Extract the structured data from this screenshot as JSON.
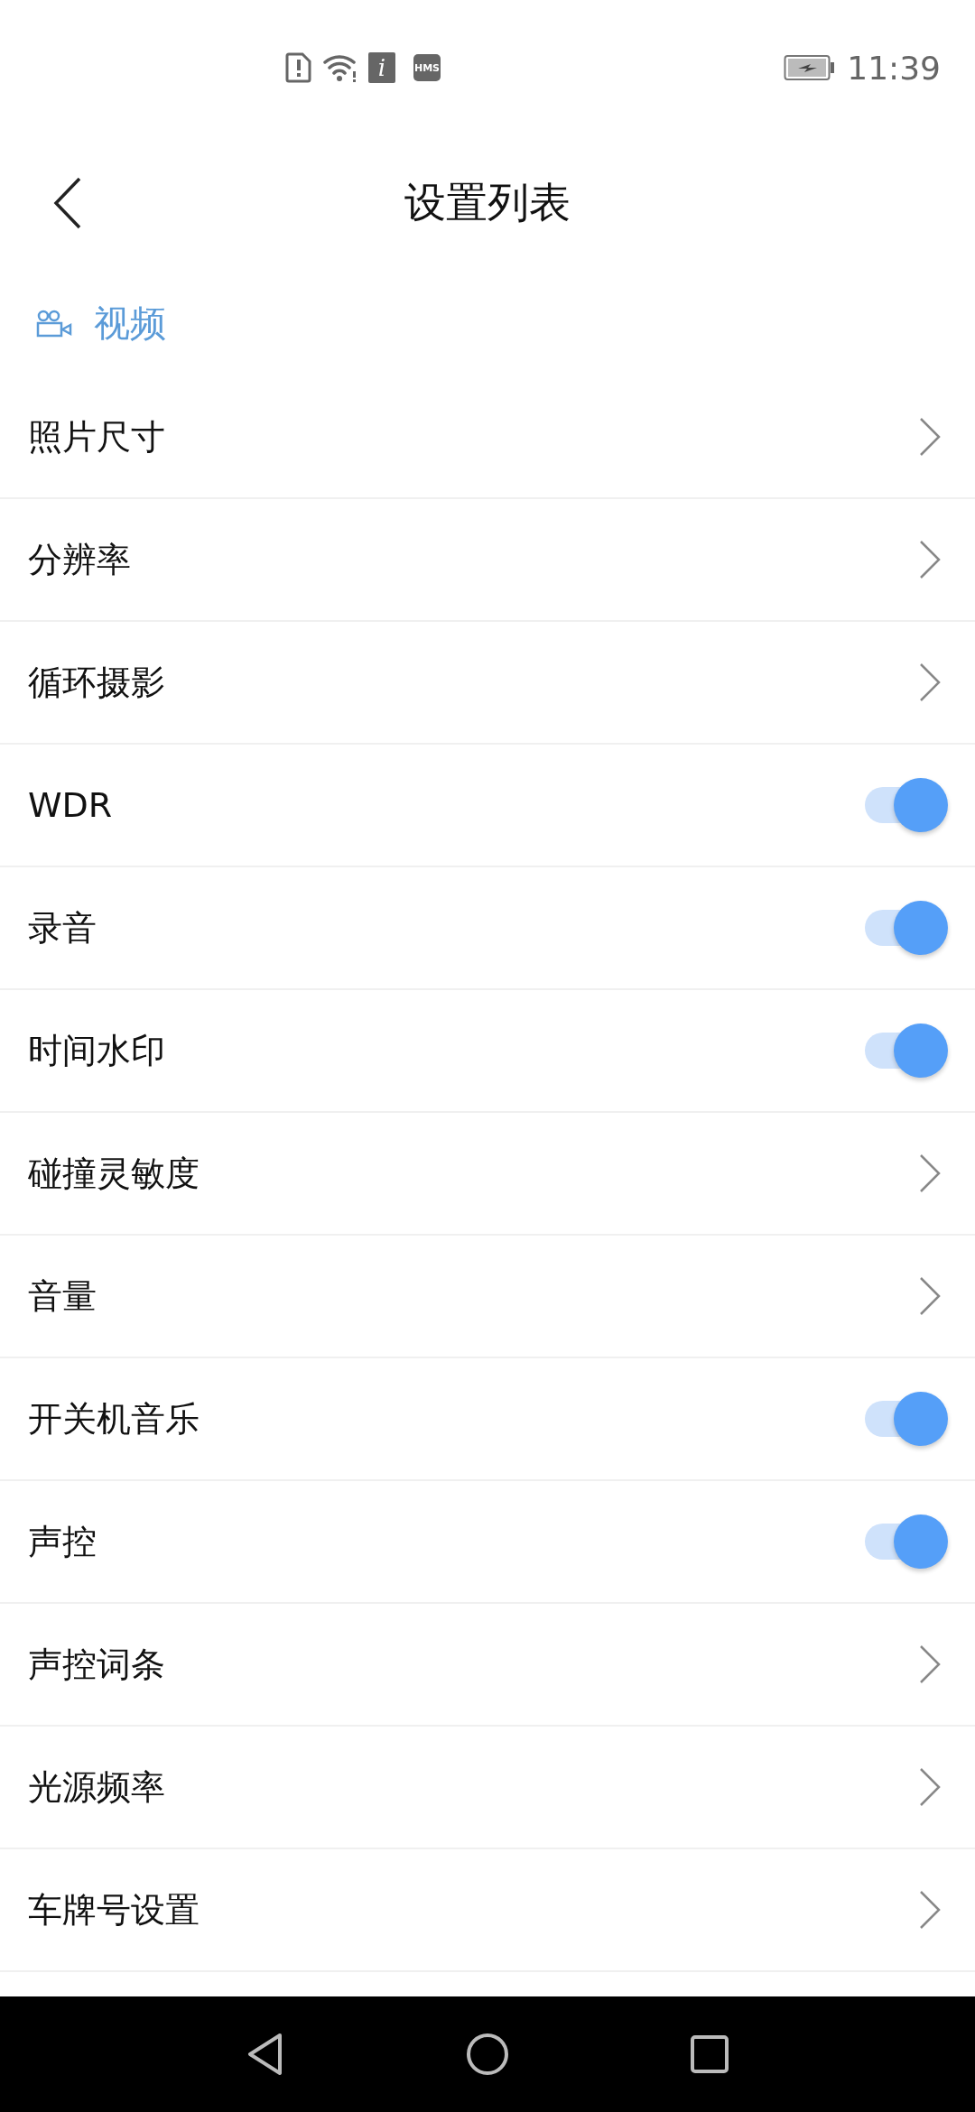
{
  "status_bar": {
    "info_badge": "i",
    "hms_badge": "HMS",
    "time": "11:39"
  },
  "header": {
    "title": "设置列表"
  },
  "section": {
    "title": "视频"
  },
  "rows": [
    {
      "kind": "link",
      "label": "照片尺寸"
    },
    {
      "kind": "link",
      "label": "分辨率"
    },
    {
      "kind": "link",
      "label": "循环摄影"
    },
    {
      "kind": "toggle",
      "label": "WDR",
      "on": true
    },
    {
      "kind": "toggle",
      "label": "录音",
      "on": true
    },
    {
      "kind": "toggle",
      "label": "时间水印",
      "on": true
    },
    {
      "kind": "link",
      "label": "碰撞灵敏度"
    },
    {
      "kind": "link",
      "label": "音量"
    },
    {
      "kind": "toggle",
      "label": "开关机音乐",
      "on": true
    },
    {
      "kind": "toggle",
      "label": "声控",
      "on": true
    },
    {
      "kind": "link",
      "label": "声控词条"
    },
    {
      "kind": "link",
      "label": "光源频率"
    },
    {
      "kind": "link",
      "label": "车牌号设置"
    }
  ]
}
